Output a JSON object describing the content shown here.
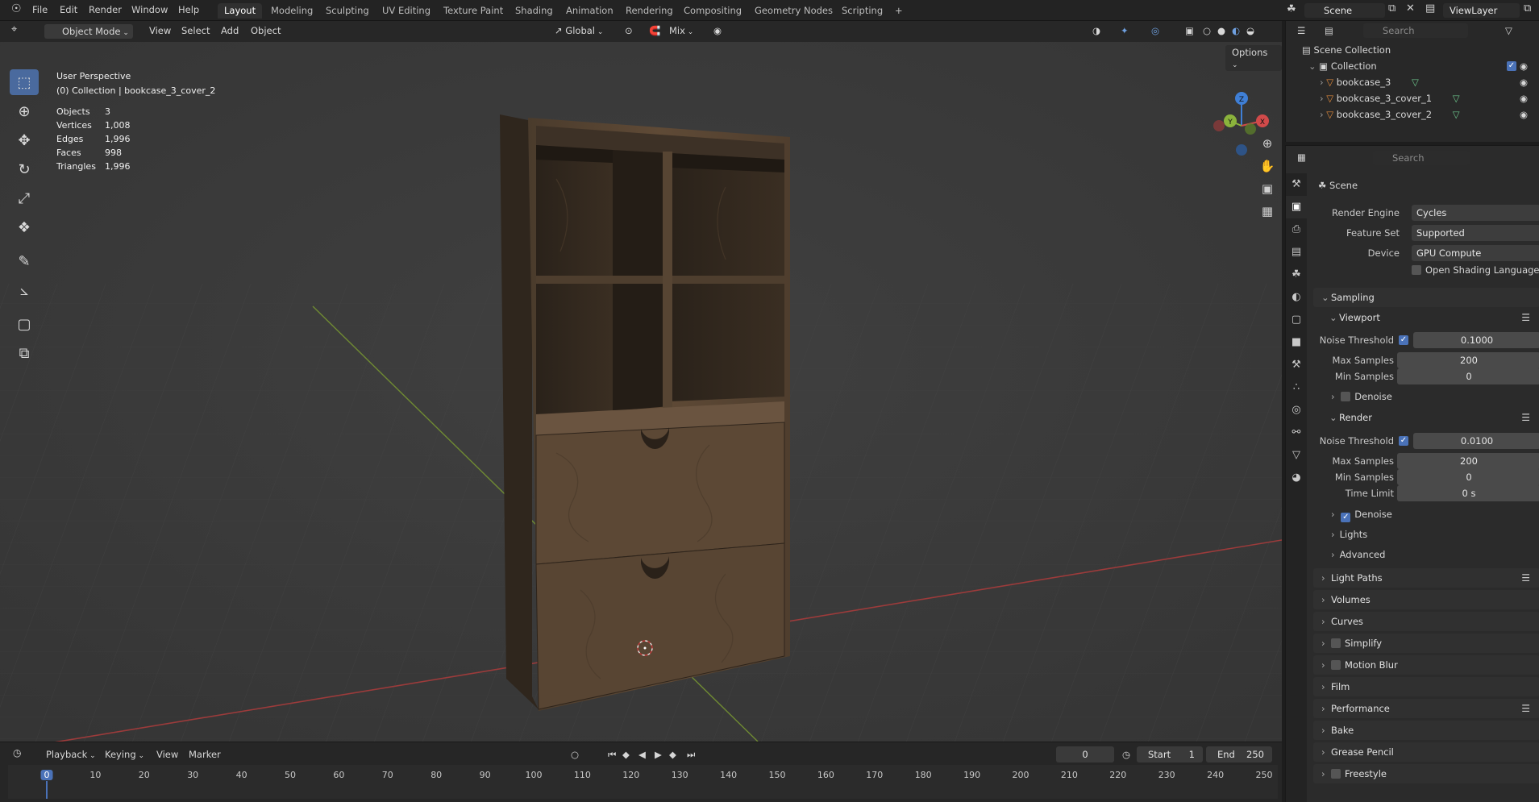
{
  "menu": {
    "file": "File",
    "edit": "Edit",
    "render": "Render",
    "window": "Window",
    "help": "Help"
  },
  "workspaces": [
    "Layout",
    "Modeling",
    "Sculpting",
    "UV Editing",
    "Texture Paint",
    "Shading",
    "Animation",
    "Rendering",
    "Compositing",
    "Geometry Nodes",
    "Scripting"
  ],
  "workspace_add": "+",
  "scene_name": "Scene",
  "view_layer": "ViewLayer",
  "viewport_header": {
    "mode": "Object Mode",
    "view": "View",
    "select": "Select",
    "add": "Add",
    "object": "Object",
    "orientation": "Global",
    "snap_mix": "Mix",
    "options": "Options"
  },
  "viewport_info": {
    "perspective": "User Perspective",
    "collection": "(0) Collection | bookcase_3_cover_2"
  },
  "stats": {
    "objects_label": "Objects",
    "objects": "3",
    "vertices_label": "Vertices",
    "vertices": "1,008",
    "edges_label": "Edges",
    "edges": "1,996",
    "faces_label": "Faces",
    "faces": "998",
    "triangles_label": "Triangles",
    "triangles": "1,996"
  },
  "gizmo_axes": {
    "z": "Z",
    "y": "Y",
    "x": "X"
  },
  "timeline": {
    "playback": "Playback",
    "keying": "Keying",
    "view": "View",
    "marker": "Marker",
    "current_frame": "0",
    "start_label": "Start",
    "start": "1",
    "end_label": "End",
    "end": "250",
    "ticks": [
      "0",
      "10",
      "20",
      "30",
      "40",
      "50",
      "60",
      "70",
      "80",
      "90",
      "100",
      "110",
      "120",
      "130",
      "140",
      "150",
      "160",
      "170",
      "180",
      "190",
      "200",
      "210",
      "220",
      "230",
      "240",
      "250"
    ]
  },
  "outliner": {
    "search_placeholder": "Search",
    "scene_collection": "Scene Collection",
    "collection": "Collection",
    "items": [
      "bookcase_3",
      "bookcase_3_cover_1",
      "bookcase_3_cover_2"
    ]
  },
  "properties": {
    "search_placeholder": "Search",
    "context": "Scene",
    "render_engine_label": "Render Engine",
    "render_engine": "Cycles",
    "feature_set_label": "Feature Set",
    "feature_set": "Supported",
    "device_label": "Device",
    "device": "GPU Compute",
    "osl": "Open Shading Language",
    "sampling": "Sampling",
    "viewport": "Viewport",
    "noise_threshold_label": "Noise Threshold",
    "vp_noise_threshold": "0.1000",
    "max_samples_label": "Max Samples",
    "vp_max_samples": "200",
    "min_samples_label": "Min Samples",
    "vp_min_samples": "0",
    "denoise": "Denoise",
    "render": "Render",
    "r_noise_threshold": "0.0100",
    "r_max_samples": "200",
    "r_min_samples": "0",
    "time_limit_label": "Time Limit",
    "time_limit": "0 s",
    "lights": "Lights",
    "advanced": "Advanced",
    "panels": [
      "Light Paths",
      "Volumes",
      "Curves",
      "Simplify",
      "Motion Blur",
      "Film",
      "Performance",
      "Bake",
      "Grease Pencil",
      "Freestyle"
    ]
  },
  "colors": {
    "accent": "#4a72b8",
    "viewport_bg": "#3b3b3b",
    "axis_x": "#d14a4a",
    "axis_y": "#8bb33c",
    "axis_z": "#3f7fd6",
    "wood": "#5a4632"
  }
}
